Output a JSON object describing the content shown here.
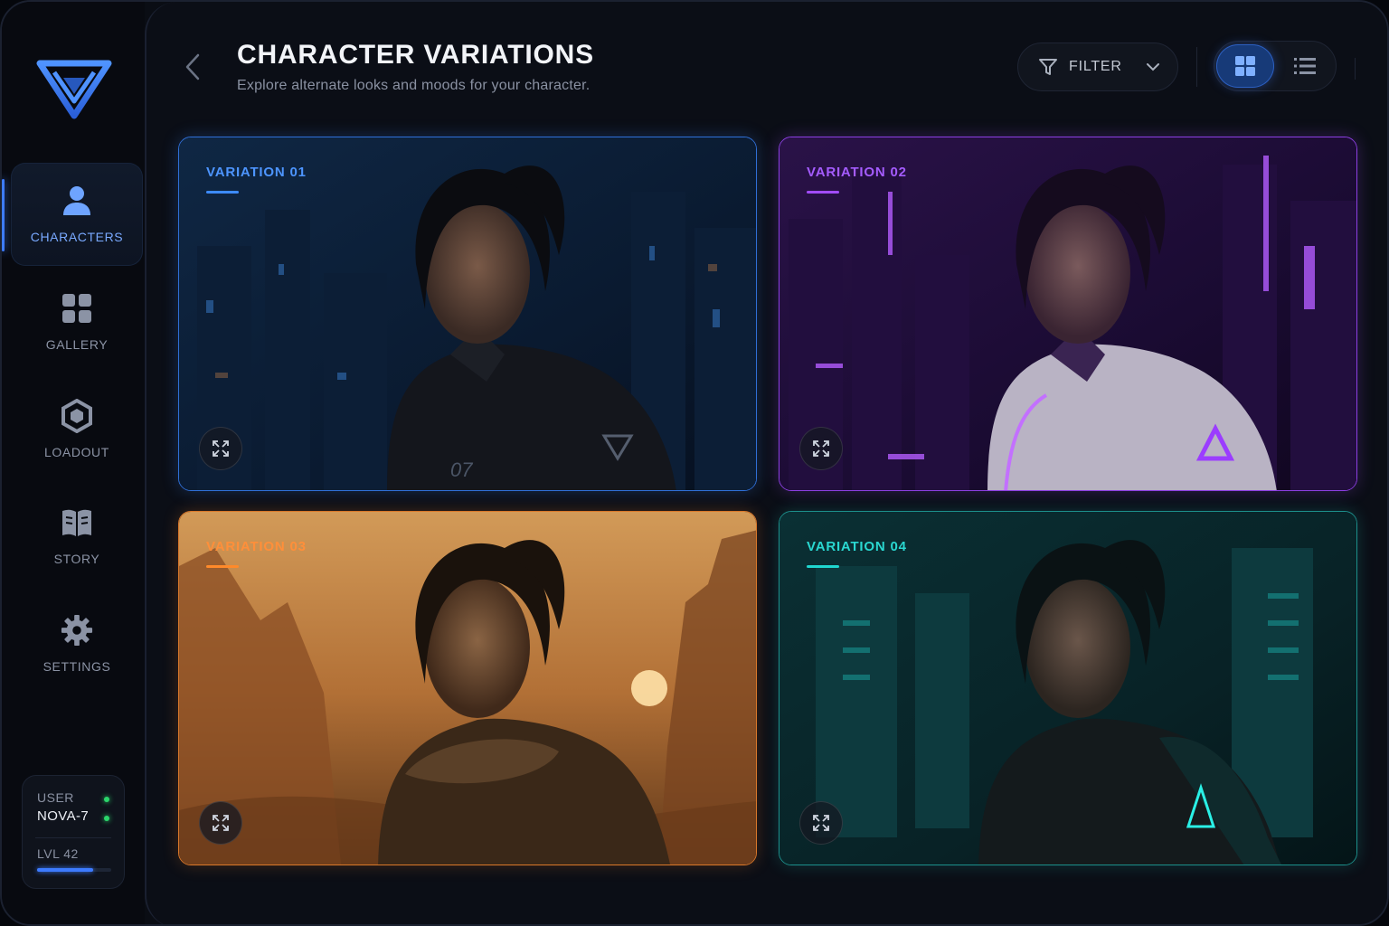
{
  "app": {
    "logo": "triangle-emblem-logo"
  },
  "sidebar": {
    "items": [
      {
        "label": "CHARACTERS",
        "icon": "user-icon",
        "active": true
      },
      {
        "label": "GALLERY",
        "icon": "grid-icon",
        "active": false
      },
      {
        "label": "LOADOUT",
        "icon": "hexagon-icon",
        "active": false
      },
      {
        "label": "STORY",
        "icon": "book-icon",
        "active": false
      },
      {
        "label": "SETTINGS",
        "icon": "gear-icon",
        "active": false
      }
    ]
  },
  "user": {
    "label": "USER",
    "name": "NOVA-7",
    "level": "LVL 42",
    "level_progress": 0.75,
    "status_color": "#2bd66b"
  },
  "header": {
    "title": "CHARACTER VARIATIONS",
    "subtitle": "Explore alternate looks and moods for your character.",
    "filter_label": "FILTER",
    "view_mode": "grid"
  },
  "variations": [
    {
      "label": "VARIATION 01",
      "accent": "#3d8bff",
      "theme": "blue night city"
    },
    {
      "label": "VARIATION 02",
      "accent": "#a24cff",
      "theme": "purple neon city"
    },
    {
      "label": "VARIATION 03",
      "accent": "#ff8a2a",
      "theme": "desert sunset"
    },
    {
      "label": "VARIATION 04",
      "accent": "#1fd6cf",
      "theme": "teal corridor"
    }
  ],
  "colors": {
    "primary": "#3d7bff",
    "background": "#0a0d14"
  }
}
